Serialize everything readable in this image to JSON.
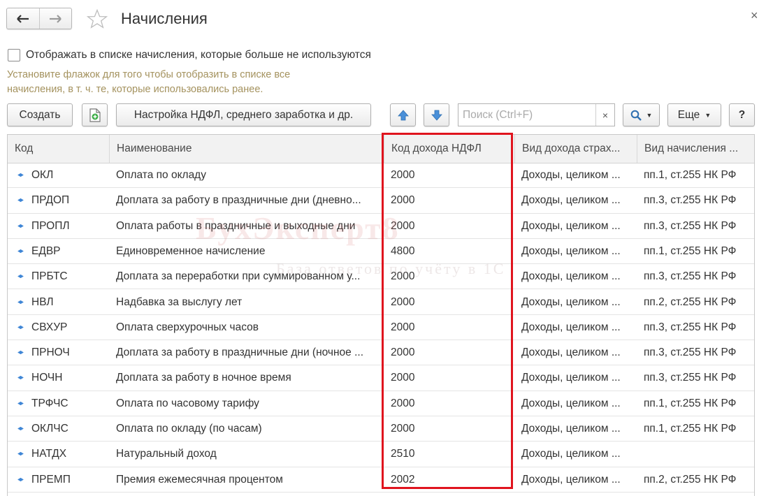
{
  "window": {
    "title": "Начисления",
    "close_glyph": "×"
  },
  "nav": {
    "back_icon": "arrow-left-icon",
    "forward_icon": "arrow-right-icon",
    "favorite_icon": "star-icon"
  },
  "filter": {
    "checkbox_label": "Отображать в списке начисления, которые больше не используются",
    "checked": false,
    "hint": "Установите флажок для того чтобы отобразить в списке все начисления, в т. ч. те, которые использовались ранее."
  },
  "toolbar": {
    "create_label": "Создать",
    "settings_label": "Настройка НДФЛ, среднего заработка и др.",
    "search_placeholder": "Поиск (Ctrl+F)",
    "search_clear": "×",
    "more_label": "Еще",
    "help_label": "?",
    "accent": "#4a90d9"
  },
  "table": {
    "columns": [
      "Код",
      "Наименование",
      "Код дохода НДФЛ",
      "Вид дохода страх...",
      "Вид начисления ..."
    ],
    "rows": [
      [
        "ОКЛ",
        "Оплата по окладу",
        "2000",
        "Доходы, целиком ...",
        "пп.1, ст.255 НК РФ"
      ],
      [
        "ПРДОП",
        "Доплата за работу в праздничные дни (дневно...",
        "2000",
        "Доходы, целиком ...",
        "пп.3, ст.255 НК РФ"
      ],
      [
        "ПРОПЛ",
        "Оплата работы в праздничные и выходные дни",
        "2000",
        "Доходы, целиком ...",
        "пп.3, ст.255 НК РФ"
      ],
      [
        "ЕДВР",
        "Единовременное начисление",
        "4800",
        "Доходы, целиком ...",
        "пп.1, ст.255 НК РФ"
      ],
      [
        "ПРБТС",
        "Доплата за переработки при суммированном у...",
        "2000",
        "Доходы, целиком ...",
        "пп.3, ст.255 НК РФ"
      ],
      [
        "НВЛ",
        "Надбавка за выслугу лет",
        "2000",
        "Доходы, целиком ...",
        "пп.2, ст.255 НК РФ"
      ],
      [
        "СВХУР",
        "Оплата сверхурочных часов",
        "2000",
        "Доходы, целиком ...",
        "пп.3, ст.255 НК РФ"
      ],
      [
        "ПРНОЧ",
        "Доплата за работу в праздничные дни (ночное ...",
        "2000",
        "Доходы, целиком ...",
        "пп.3, ст.255 НК РФ"
      ],
      [
        "НОЧН",
        "Доплата за работу в ночное время",
        "2000",
        "Доходы, целиком ...",
        "пп.3, ст.255 НК РФ"
      ],
      [
        "ТРФЧС",
        "Оплата по часовому тарифу",
        "2000",
        "Доходы, целиком ...",
        "пп.1, ст.255 НК РФ"
      ],
      [
        "ОКЛЧС",
        "Оплата по окладу (по часам)",
        "2000",
        "Доходы, целиком ...",
        "пп.1, ст.255 НК РФ"
      ],
      [
        "НАТДХ",
        "Натуральный доход",
        "2510",
        "Доходы, целиком ...",
        ""
      ],
      [
        "ПРЕМП",
        "Премия ежемесячная процентом",
        "2002",
        "Доходы, целиком ...",
        "пп.2, ст.255 НК РФ"
      ]
    ],
    "row_icon": "diamond-icon",
    "highlight_color": "#e0141e"
  },
  "watermark": {
    "title": "БухЭксперт8",
    "subtitle": "База ответов по учёту в 1С"
  }
}
